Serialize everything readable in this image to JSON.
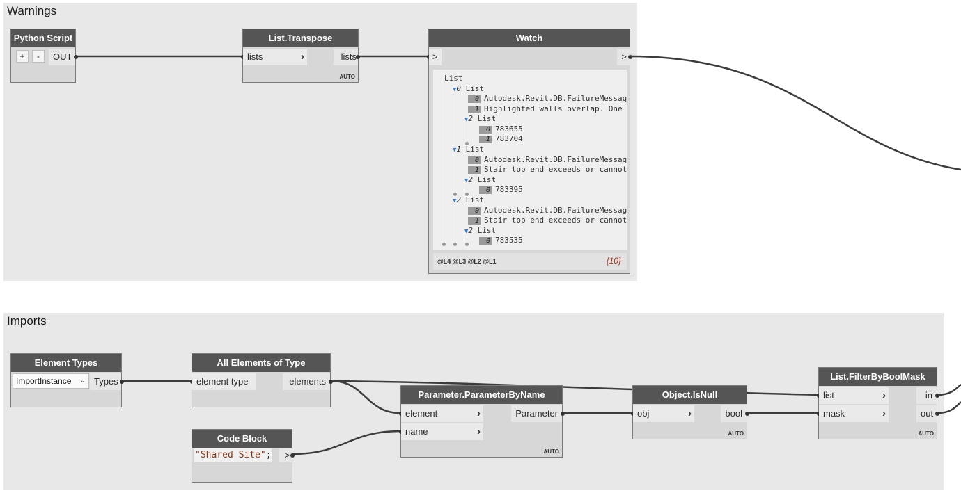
{
  "groups": {
    "warnings": "Warnings",
    "imports": "Imports"
  },
  "python_script": {
    "title": "Python Script",
    "add": "+",
    "remove": "-",
    "out": "OUT"
  },
  "transpose": {
    "title": "List.Transpose",
    "input": "lists",
    "output": "lists",
    "lacing": "AUTO"
  },
  "watch": {
    "title": "Watch",
    "in_port": ">",
    "out_port": ">",
    "rows": [
      {
        "text": "List"
      },
      {
        "index": "0",
        "text": "List"
      },
      {
        "index": "0",
        "text": "Autodesk.Revit.DB.FailureMessag"
      },
      {
        "index": "1",
        "text": "Highlighted walls overlap. One"
      },
      {
        "index": "2",
        "text": "List"
      },
      {
        "index": "0",
        "text": "783655"
      },
      {
        "index": "1",
        "text": "783704"
      },
      {
        "index": "1",
        "text": "List"
      },
      {
        "index": "0",
        "text": "Autodesk.Revit.DB.FailureMessag"
      },
      {
        "index": "1",
        "text": "Stair top end exceeds or cannot"
      },
      {
        "index": "2",
        "text": "List"
      },
      {
        "index": "0",
        "text": "783395"
      },
      {
        "index": "2",
        "text": "List"
      },
      {
        "index": "0",
        "text": "Autodesk.Revit.DB.FailureMessag"
      },
      {
        "index": "1",
        "text": "Stair top end exceeds or cannot"
      },
      {
        "index": "2",
        "text": "List"
      },
      {
        "index": "0",
        "text": "783535"
      }
    ],
    "levels": [
      "@L4",
      "@L3",
      "@L2",
      "@L1"
    ],
    "count": "{10}"
  },
  "element_types": {
    "title": "Element Types",
    "selected": "ImportInstance",
    "output": "Types"
  },
  "all_elements": {
    "title": "All Elements of Type",
    "input": "element type",
    "output": "elements"
  },
  "param_by_name": {
    "title": "Parameter.ParameterByName",
    "input_element": "element",
    "input_name": "name",
    "output": "Parameter",
    "lacing": "AUTO"
  },
  "code_block": {
    "title": "Code Block",
    "code_string": "\"Shared Site\"",
    "code_end": ";",
    "output": ">"
  },
  "is_null": {
    "title": "Object.IsNull",
    "input": "obj",
    "output": "bool",
    "lacing": "AUTO"
  },
  "filter": {
    "title": "List.FilterByBoolMask",
    "input_list": "list",
    "input_mask": "mask",
    "output_in": "in",
    "output_out": "out",
    "lacing": "AUTO"
  },
  "colors": {
    "canvas": "#ffffff",
    "group": "#e8e8e8",
    "node_header": "#555555",
    "node_body": "#d7d7d7",
    "wire": "#3c3c3c",
    "accent_triangle": "#3a78c8",
    "count_text": "#a0301a"
  }
}
